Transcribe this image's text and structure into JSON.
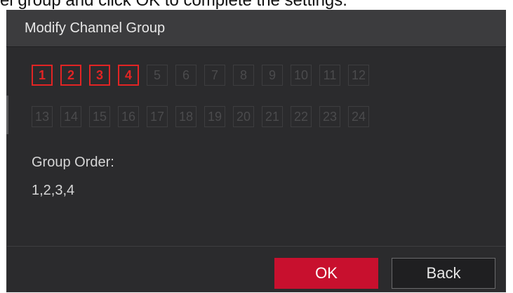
{
  "caption": "el group and click OK to complete the settings.",
  "dialog": {
    "title": "Modify Channel Group",
    "channels_row1": [
      "1",
      "2",
      "3",
      "4",
      "5",
      "6",
      "7",
      "8",
      "9",
      "10",
      "11",
      "12"
    ],
    "channels_row2": [
      "13",
      "14",
      "15",
      "16",
      "17",
      "18",
      "19",
      "20",
      "21",
      "22",
      "23",
      "24"
    ],
    "selected_channels": [
      "1",
      "2",
      "3",
      "4"
    ],
    "group_order_label": "Group Order:",
    "group_order_value": "1,2,3,4",
    "ok_label": "OK",
    "back_label": "Back"
  },
  "colors": {
    "accent": "#c8102e",
    "selected_border": "#e22424",
    "background": "#2b2b2d"
  }
}
